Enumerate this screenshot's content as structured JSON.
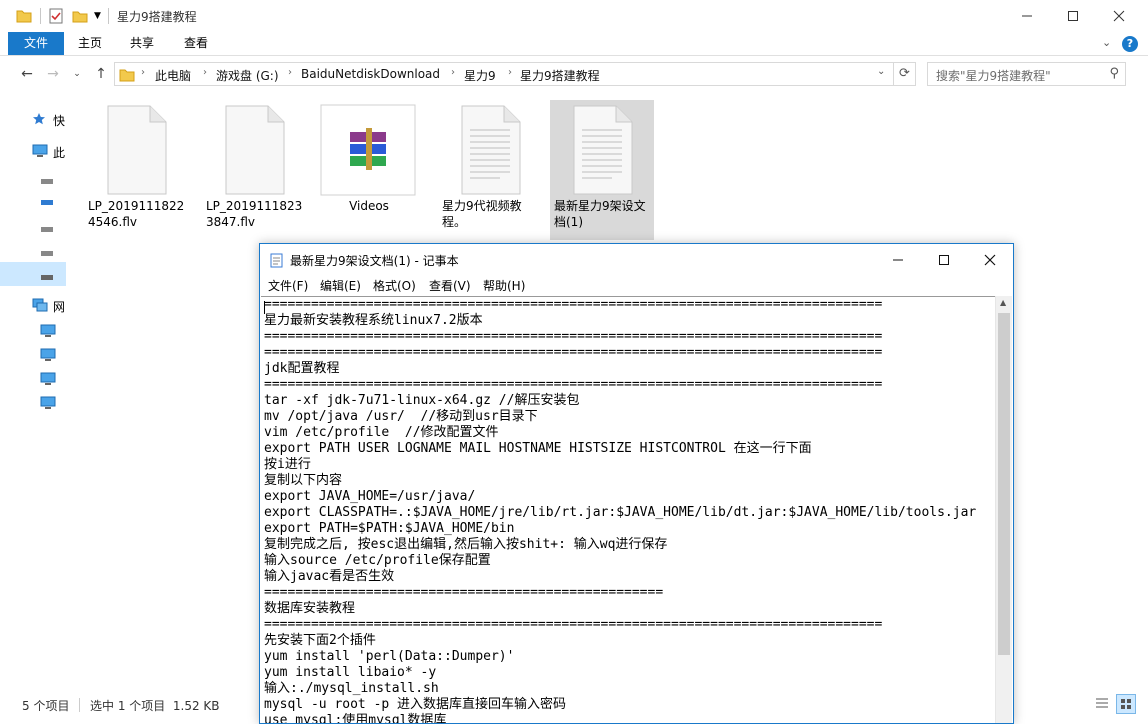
{
  "explorer": {
    "title": "星力9搭建教程",
    "ribbon_tabs": [
      "文件",
      "主页",
      "共享",
      "查看"
    ],
    "breadcrumbs": [
      "此电脑",
      "游戏盘 (G:)",
      "BaiduNetdiskDownload",
      "星力9",
      "星力9搭建教程"
    ],
    "search_placeholder": "搜索\"星力9搭建教程\"",
    "nav_items": [
      {
        "label": "快",
        "icon": "star-icon"
      },
      {
        "label": "此",
        "icon": "computer-icon"
      },
      {
        "label": "",
        "icon": "drive-icon"
      },
      {
        "label": "",
        "icon": "drive-icon"
      },
      {
        "label": "",
        "icon": "drive-icon"
      },
      {
        "label": "",
        "icon": "drive-icon"
      },
      {
        "label": "",
        "icon": "drive-icon"
      },
      {
        "label": "网",
        "icon": "network-icon"
      },
      {
        "label": "",
        "icon": "monitor-icon"
      },
      {
        "label": "",
        "icon": "monitor-icon"
      },
      {
        "label": "",
        "icon": "monitor-icon"
      },
      {
        "label": "",
        "icon": "monitor-icon"
      }
    ],
    "files": [
      {
        "name": "LP_20191118224546.flv",
        "display": "LP_2019111822\n4546.flv",
        "icon": "blank-file-icon"
      },
      {
        "name": "LP_20191118233847.flv",
        "display": "LP_2019111823\n3847.flv",
        "icon": "blank-file-icon"
      },
      {
        "name": "Videos",
        "display": "Videos",
        "icon": "winrar-archive-icon"
      },
      {
        "name": "星力9代视频教程。",
        "display": "星力9代视频教\n程。",
        "icon": "text-file-icon"
      },
      {
        "name": "最新星力9架设文档(1)",
        "display": "最新星力9架设文\n档(1)",
        "icon": "text-file-icon"
      }
    ],
    "status_count": "5 个项目",
    "status_selected": "选中 1 个项目  1.52 KB"
  },
  "notepad": {
    "title": "最新星力9架设文档(1) - 记事本",
    "menus": [
      "文件(F)",
      "编辑(E)",
      "格式(O)",
      "查看(V)",
      "帮助(H)"
    ],
    "lines": [
      "===============================================================================",
      "星力最新安装教程系统linux7.2版本",
      "===============================================================================",
      "===============================================================================",
      "jdk配置教程",
      "===============================================================================",
      "tar -xf jdk-7u71-linux-x64.gz //解压安装包",
      "mv /opt/java /usr/  //移动到usr目录下",
      "vim /etc/profile  //修改配置文件",
      "export PATH USER LOGNAME MAIL HOSTNAME HISTSIZE HISTCONTROL 在这一行下面",
      "按i进行",
      "复制以下内容",
      "export JAVA_HOME=/usr/java/",
      "export CLASSPATH=.:$JAVA_HOME/jre/lib/rt.jar:$JAVA_HOME/lib/dt.jar:$JAVA_HOME/lib/tools.jar",
      "export PATH=$PATH:$JAVA_HOME/bin",
      "复制完成之后, 按esc退出编辑,然后输入按shit+: 输入wq进行保存",
      "输入source /etc/profile保存配置",
      "输入javac看是否生效",
      "===================================================",
      "数据库安装教程",
      "===============================================================================",
      "先安装下面2个插件",
      "yum install 'perl(Data::Dumper)'",
      "yum install libaio* -y",
      "输入:./mysql_install.sh",
      "mysql -u root -p 进入数据库直接回车输入密码",
      "use mysql;使用mysql数据库"
    ]
  },
  "colors": {
    "accent": "#1979ca",
    "selection": "#cce8ff",
    "selected_file": "#d9d9d9"
  }
}
